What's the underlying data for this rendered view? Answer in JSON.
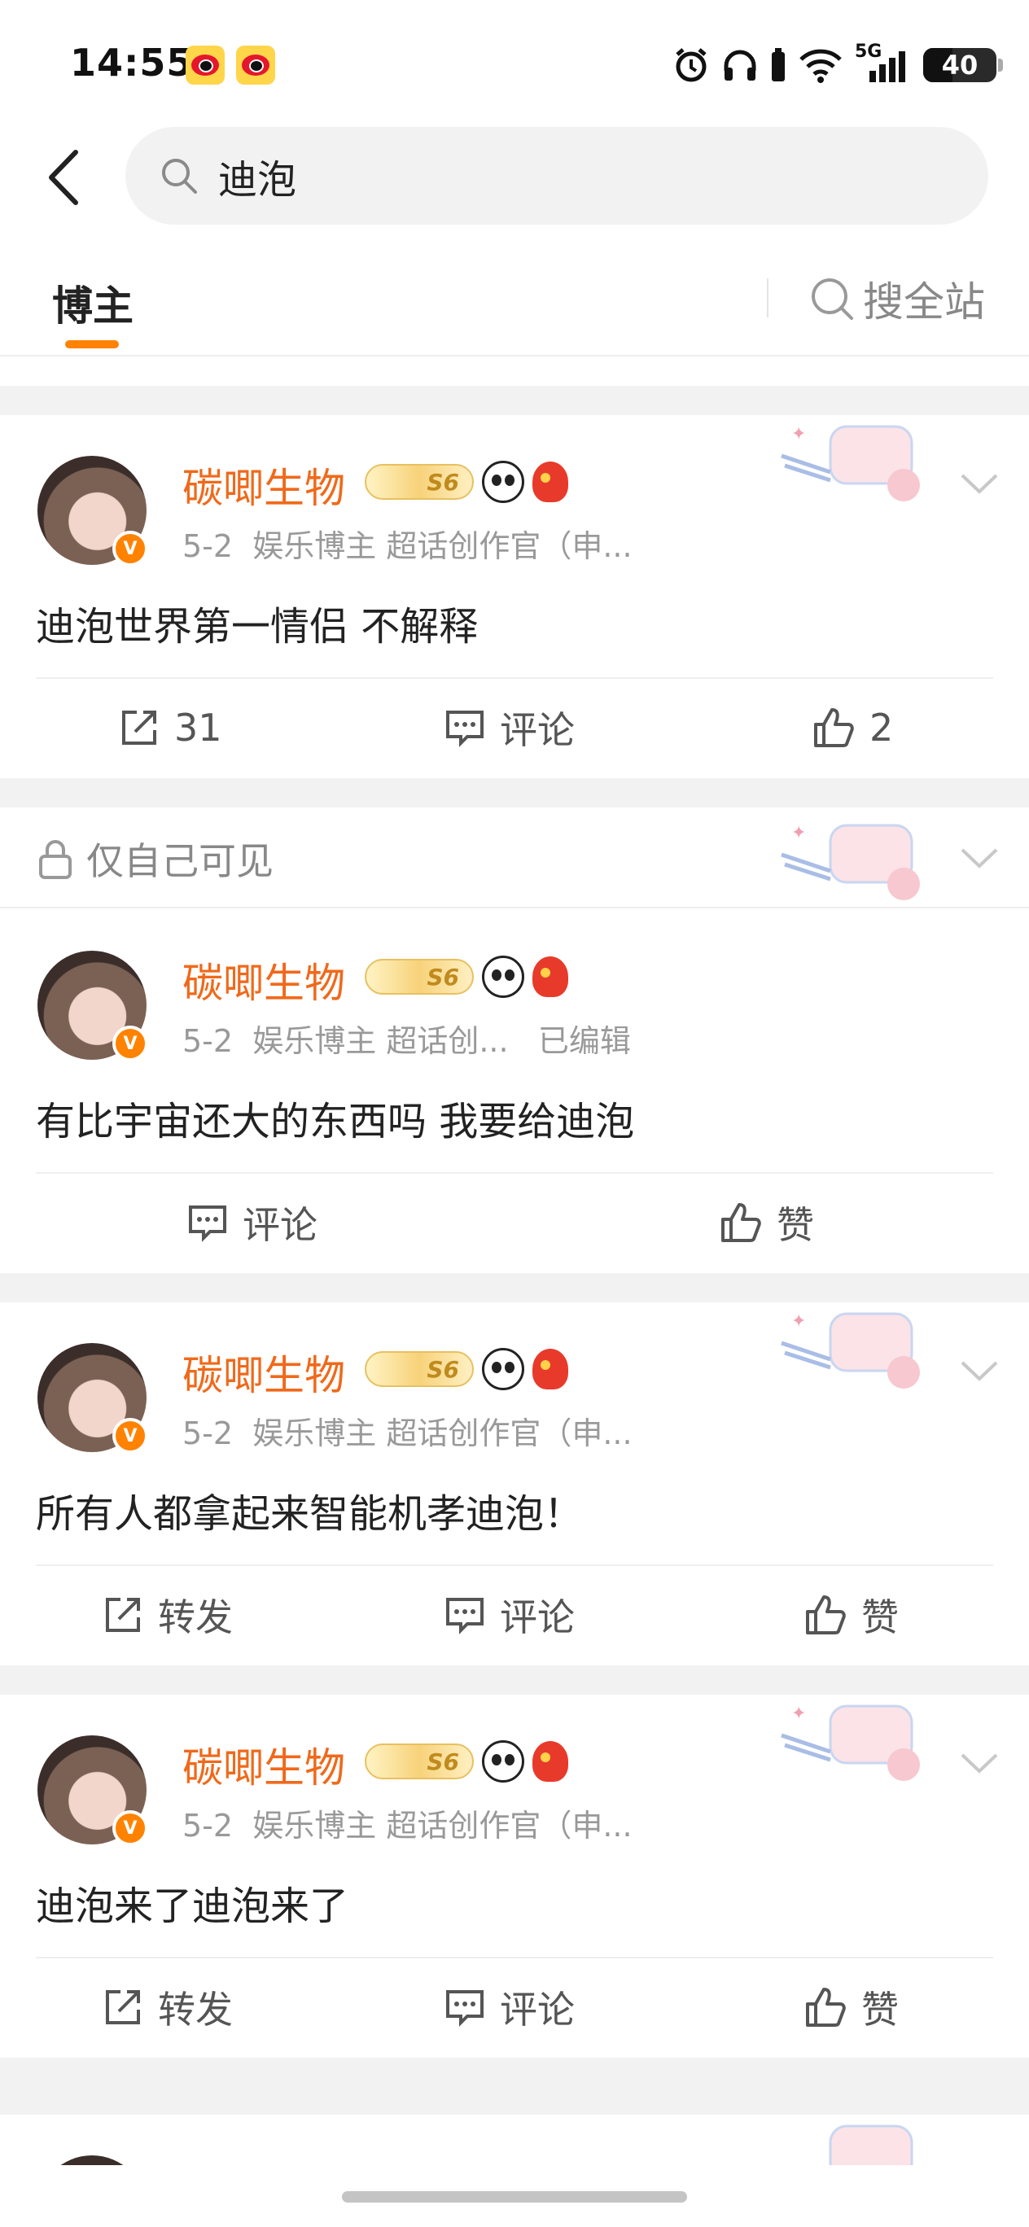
{
  "status_bar": {
    "time": "14:55",
    "network": "5G",
    "battery": "40"
  },
  "search": {
    "query": "迪泡"
  },
  "tabs": {
    "active": "博主",
    "search_all": "搜全站"
  },
  "posts": [
    {
      "author": "碳唧生物",
      "level_badge": "S6",
      "date": "5-2",
      "meta": "娱乐博主 超话创作官（申...",
      "text": "迪泡世界第一情侣 不解释",
      "repost": "31",
      "comment": "评论",
      "like": "2"
    },
    {
      "private_label": "仅自己可见",
      "author": "碳唧生物",
      "level_badge": "S6",
      "date": "5-2",
      "meta": "娱乐博主 超话创...",
      "edited": "已编辑",
      "text": "有比宇宙还大的东西吗 我要给迪泡",
      "comment": "评论",
      "like": "赞"
    },
    {
      "author": "碳唧生物",
      "level_badge": "S6",
      "date": "5-2",
      "meta": "娱乐博主 超话创作官（申...",
      "text": "所有人都拿起来智能机孝迪泡！",
      "repost": "转发",
      "comment": "评论",
      "like": "赞"
    },
    {
      "author": "碳唧生物",
      "level_badge": "S6",
      "date": "5-2",
      "meta": "娱乐博主 超话创作官（申...",
      "text": "迪泡来了迪泡来了",
      "repost": "转发",
      "comment": "评论",
      "like": "赞"
    }
  ]
}
